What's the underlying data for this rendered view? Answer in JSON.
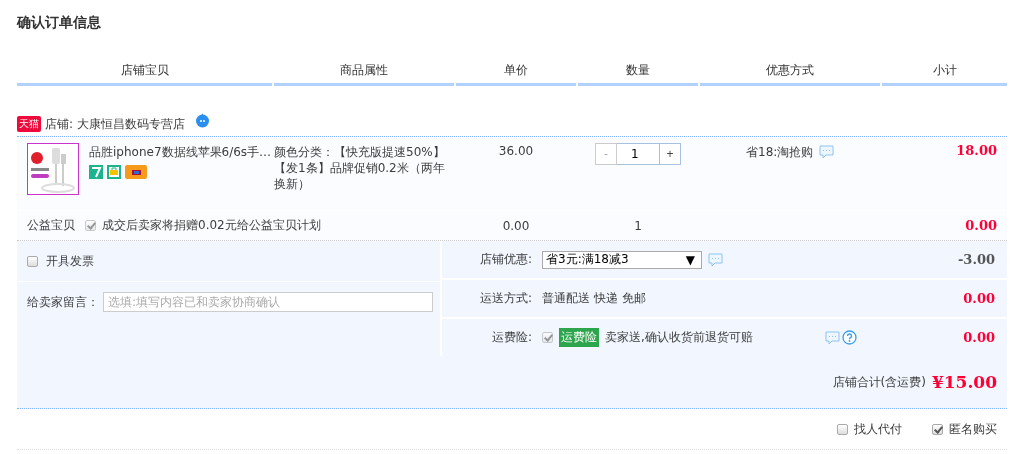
{
  "title": "确认订单信息",
  "columns": [
    "店铺宝贝",
    "商品属性",
    "单价",
    "数量",
    "优惠方式",
    "小计"
  ],
  "shop": {
    "badge": "天猫",
    "label": "店铺:",
    "name": "大康恒昌数码专营店"
  },
  "item": {
    "name": "品胜iphone7数据线苹果6/6s手…",
    "attributes": "颜色分类：【快充版提速50%】【发1条】品牌促销0.2米（两年换新）",
    "price": "36.00",
    "minus": "-",
    "quantity": "1",
    "plus": "+",
    "discount": "省18:淘抢购",
    "subtotal": "18.00"
  },
  "charity": {
    "label": "公益宝贝",
    "checked": true,
    "text": "成交后卖家将捐赠0.02元给公益宝贝计划",
    "price": "0.00",
    "quantity": "1",
    "subtotal": "0.00"
  },
  "invoice": {
    "label": "开具发票",
    "checked": false
  },
  "message": {
    "label": "给卖家留言：",
    "placeholder": "选填:填写内容已和卖家协商确认"
  },
  "shop_discount": {
    "label": "店铺优惠:",
    "value": "省3元:满18减3",
    "arrow": "▼",
    "amount": "-3.00"
  },
  "shipping": {
    "label": "运送方式:",
    "value": "普通配送 快递 免邮",
    "amount": "0.00"
  },
  "insurance": {
    "label": "运费险:",
    "checked": true,
    "tag": "运费险",
    "text": "卖家送,确认收货前退货可赔",
    "amount": "0.00"
  },
  "total": {
    "label": "店铺合计(含运费)",
    "amount": "¥15.00"
  },
  "options": [
    {
      "label": "找人代付",
      "checked": false
    },
    {
      "label": "匿名购买",
      "checked": true
    }
  ]
}
